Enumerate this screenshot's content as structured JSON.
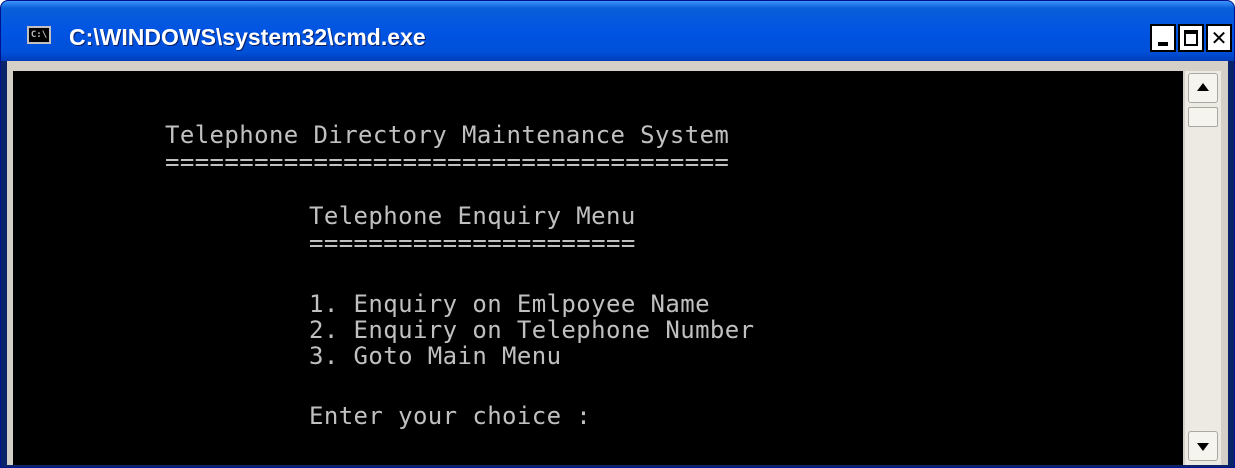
{
  "window": {
    "title": "C:\\WINDOWS\\system32\\cmd.exe",
    "icon_text": "C:\\",
    "icon": "console-icon",
    "controls": {
      "minimize_icon": "minimize-icon",
      "maximize_icon": "maximize-icon",
      "close_icon": "close-icon",
      "close_glyph": "✕"
    }
  },
  "console": {
    "header_title": "Telephone Directory Maintenance System",
    "header_rule": "======================================",
    "menu_title": "Telephone Enquiry Menu",
    "menu_rule": "======================",
    "options": [
      "1. Enquiry on Emlpoyee Name",
      "2. Enquiry on Telephone Number",
      "3. Goto Main Menu"
    ],
    "prompt": "Enter your choice :"
  },
  "scrollbar": {
    "up_icon": "scroll-up-arrow-icon",
    "down_icon": "scroll-down-arrow-icon"
  },
  "colors": {
    "titlebar": "#0054e3",
    "console_background": "#000000",
    "console_text": "#c0c0c0"
  }
}
